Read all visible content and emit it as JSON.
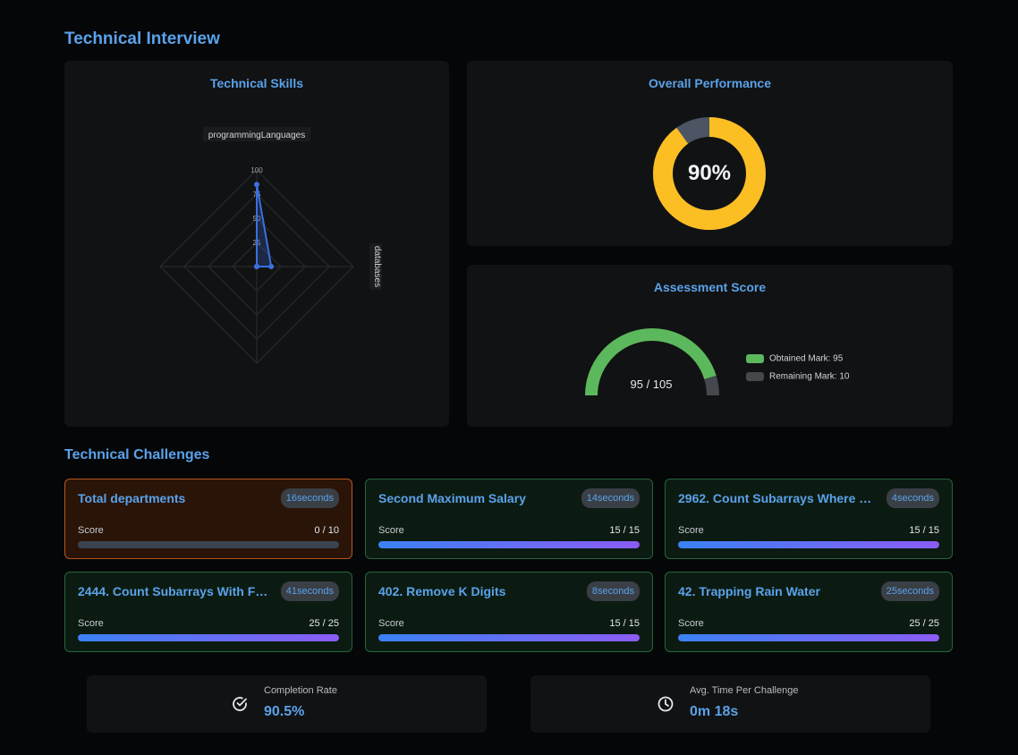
{
  "page": {
    "title": "Technical Interview"
  },
  "skills_chart": {
    "title": "Technical Skills"
  },
  "performance": {
    "title": "Overall Performance",
    "percent_label": "90%",
    "value": 90
  },
  "assessment": {
    "title": "Assessment Score",
    "label": "95 / 105",
    "legend": [
      "Obtained Mark: 95",
      "Remaining Mark: 10"
    ]
  },
  "chart_data": [
    {
      "type": "radar",
      "title": "Technical Skills",
      "axes": [
        "programmingLanguages",
        "databases",
        "",
        ""
      ],
      "values": [
        85,
        15,
        0,
        0
      ],
      "scale_ticks": [
        "100",
        "75",
        "50",
        "25"
      ],
      "range": [
        0,
        100
      ],
      "color": "#3b6fe0"
    },
    {
      "type": "pie",
      "title": "Overall Performance",
      "values": [
        90,
        10
      ],
      "colors": [
        "#fbbf24",
        "#4b5563"
      ]
    },
    {
      "type": "pie",
      "title": "Assessment Score",
      "categories": [
        "Obtained Mark",
        "Remaining Mark"
      ],
      "values": [
        95,
        10
      ],
      "colors": [
        "#5cb85c",
        "#45484d"
      ]
    }
  ],
  "challenges": {
    "title": "Technical Challenges",
    "score_label": "Score",
    "items": [
      {
        "title": "Total departments",
        "time": "16seconds",
        "score": "0 / 10",
        "ratio": 0,
        "status": "fail"
      },
      {
        "title": "Second Maximum Salary",
        "time": "14seconds",
        "score": "15 / 15",
        "ratio": 1,
        "status": "pass"
      },
      {
        "title": "2962. Count Subarrays Where …",
        "time": "4seconds",
        "score": "15 / 15",
        "ratio": 1,
        "status": "pass"
      },
      {
        "title": "2444. Count Subarrays With F…",
        "time": "41seconds",
        "score": "25 / 25",
        "ratio": 1,
        "status": "pass"
      },
      {
        "title": "402. Remove K Digits",
        "time": "8seconds",
        "score": "15 / 15",
        "ratio": 1,
        "status": "pass"
      },
      {
        "title": "42. Trapping Rain Water",
        "time": "25seconds",
        "score": "25 / 25",
        "ratio": 1,
        "status": "pass"
      }
    ]
  },
  "stats": {
    "completion": {
      "label": "Completion Rate",
      "value": "90.5%",
      "icon": "check-circle-icon"
    },
    "avg_time": {
      "label": "Avg. Time Per Challenge",
      "value": "0m 18s",
      "icon": "clock-icon"
    }
  },
  "colors": {
    "accent": "#5aa2ea",
    "pass_border": "#23663b",
    "fail_border": "#b4571f"
  }
}
